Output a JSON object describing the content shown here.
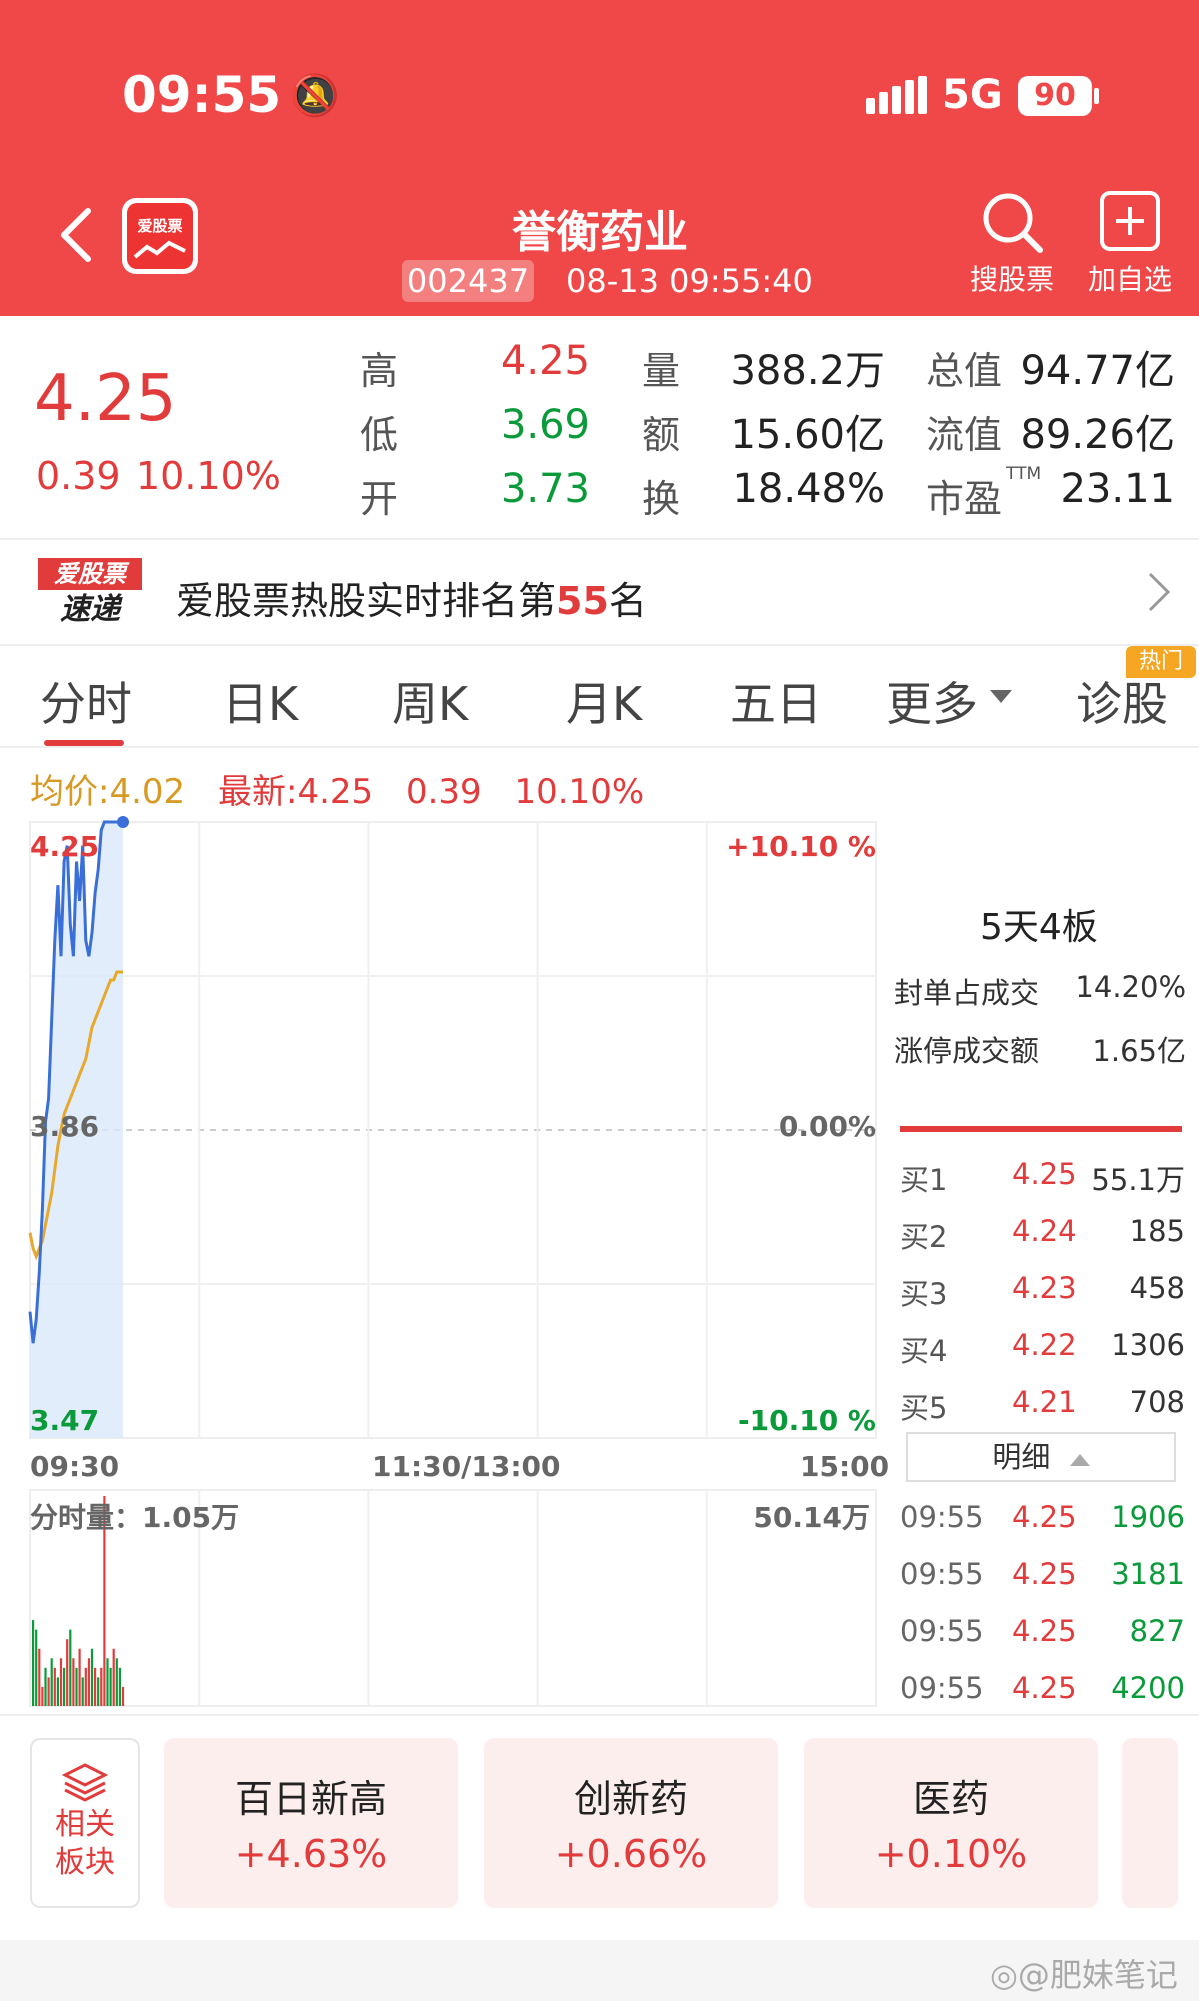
{
  "status": {
    "time": "09:55",
    "network": "5G",
    "battery": "90"
  },
  "header": {
    "title": "誉衡药业",
    "code": "002437",
    "datetime": "08-13 09:55:40",
    "logo_text": "爱股票",
    "search_label": "搜股票",
    "add_label": "加自选"
  },
  "quote": {
    "price": "4.25",
    "change": "0.39",
    "change_pct": "10.10%",
    "rows": [
      {
        "l1": "高",
        "v1": "4.25",
        "l2": "量",
        "v2": "388.2万",
        "l3": "总值",
        "v3": "94.77亿"
      },
      {
        "l1": "低",
        "v1": "3.69",
        "l2": "额",
        "v2": "15.60亿",
        "l3": "流值",
        "v3": "89.26亿"
      },
      {
        "l1": "开",
        "v1": "3.73",
        "l2": "换",
        "v2": "18.48%",
        "l3": "市盈",
        "v3": "23.11"
      }
    ],
    "ttm": "TTM"
  },
  "banner": {
    "logo_top": "爱股票",
    "logo_bottom": "速递",
    "text_a": "爱股票热股实时排名第",
    "rank": "55",
    "text_b": "名"
  },
  "tabs": {
    "items": [
      "分时",
      "日K",
      "周K",
      "月K",
      "五日",
      "更多",
      "诊股"
    ],
    "hot_badge": "热门"
  },
  "legend": {
    "avg": "均价:4.02",
    "latest": "最新:4.25",
    "chg": "0.39",
    "pct": "10.10%"
  },
  "chart_data": {
    "type": "line",
    "title": "",
    "y_labels": {
      "top": "4.25",
      "mid": "3.86",
      "bottom": "3.47"
    },
    "y_right": {
      "top": "+10.10 %",
      "mid": "0.00%",
      "bottom": "-10.10 %"
    },
    "x_labels": [
      "09:30",
      "11:30/13:00",
      "15:00"
    ],
    "ylim": [
      3.47,
      4.25
    ],
    "series": [
      {
        "values": [
          3.63,
          3.59,
          3.62,
          3.68,
          3.76,
          3.87,
          3.9,
          4.0,
          4.1,
          4.17,
          4.08,
          4.2,
          4.22,
          4.12,
          4.08,
          4.2,
          4.15,
          4.22,
          4.1,
          4.08,
          4.11,
          4.16,
          4.19,
          4.24,
          4.25,
          4.25,
          4.25,
          4.25,
          4.25,
          4.25,
          4.25
        ]
      },
      {
        "values": [
          3.73,
          3.71,
          3.7,
          3.71,
          3.72,
          3.74,
          3.76,
          3.78,
          3.81,
          3.84,
          3.86,
          3.88,
          3.89,
          3.9,
          3.91,
          3.92,
          3.93,
          3.94,
          3.95,
          3.97,
          3.99,
          4.0,
          4.01,
          4.02,
          4.03,
          4.04,
          4.05,
          4.05,
          4.06,
          4.06,
          4.06
        ]
      }
    ],
    "volume": {
      "label": "分时量：1.05万",
      "max_label": "50.14万",
      "values": [
        9,
        8,
        6,
        2,
        4,
        3,
        5,
        4,
        3,
        5,
        4,
        7,
        8,
        5,
        4,
        6,
        3,
        4,
        5,
        6,
        4,
        3,
        4,
        22,
        5,
        4,
        6,
        5,
        4,
        2
      ],
      "colors": [
        "g",
        "g",
        "r",
        "r",
        "g",
        "r",
        "g",
        "r",
        "g",
        "r",
        "g",
        "r",
        "g",
        "r",
        "g",
        "r",
        "g",
        "r",
        "r",
        "g",
        "r",
        "g",
        "r",
        "r",
        "g",
        "g",
        "r",
        "g",
        "g",
        "r"
      ]
    }
  },
  "side": {
    "title": "5天4板",
    "rows": [
      {
        "label": "封单占成交",
        "value": "14.20%"
      },
      {
        "label": "涨停成交额",
        "value": "1.65亿"
      }
    ]
  },
  "orderbook": [
    {
      "label": "买1",
      "price": "4.25",
      "vol": "55.1万"
    },
    {
      "label": "买2",
      "price": "4.24",
      "vol": "185"
    },
    {
      "label": "买3",
      "price": "4.23",
      "vol": "458"
    },
    {
      "label": "买4",
      "price": "4.22",
      "vol": "1306"
    },
    {
      "label": "买5",
      "price": "4.21",
      "vol": "708"
    }
  ],
  "detail_label": "明细",
  "trades": [
    {
      "time": "09:55",
      "price": "4.25",
      "vol": "1906"
    },
    {
      "time": "09:55",
      "price": "4.25",
      "vol": "3181"
    },
    {
      "time": "09:55",
      "price": "4.25",
      "vol": "827"
    },
    {
      "time": "09:55",
      "price": "4.25",
      "vol": "4200"
    }
  ],
  "sectors": {
    "button_line1": "相关",
    "button_line2": "板块",
    "items": [
      {
        "name": "百日新高",
        "chg": "+4.63%"
      },
      {
        "name": "创新药",
        "chg": "+0.66%"
      },
      {
        "name": "医药",
        "chg": "+0.10%"
      }
    ]
  },
  "watermark": "@肥妹笔记"
}
